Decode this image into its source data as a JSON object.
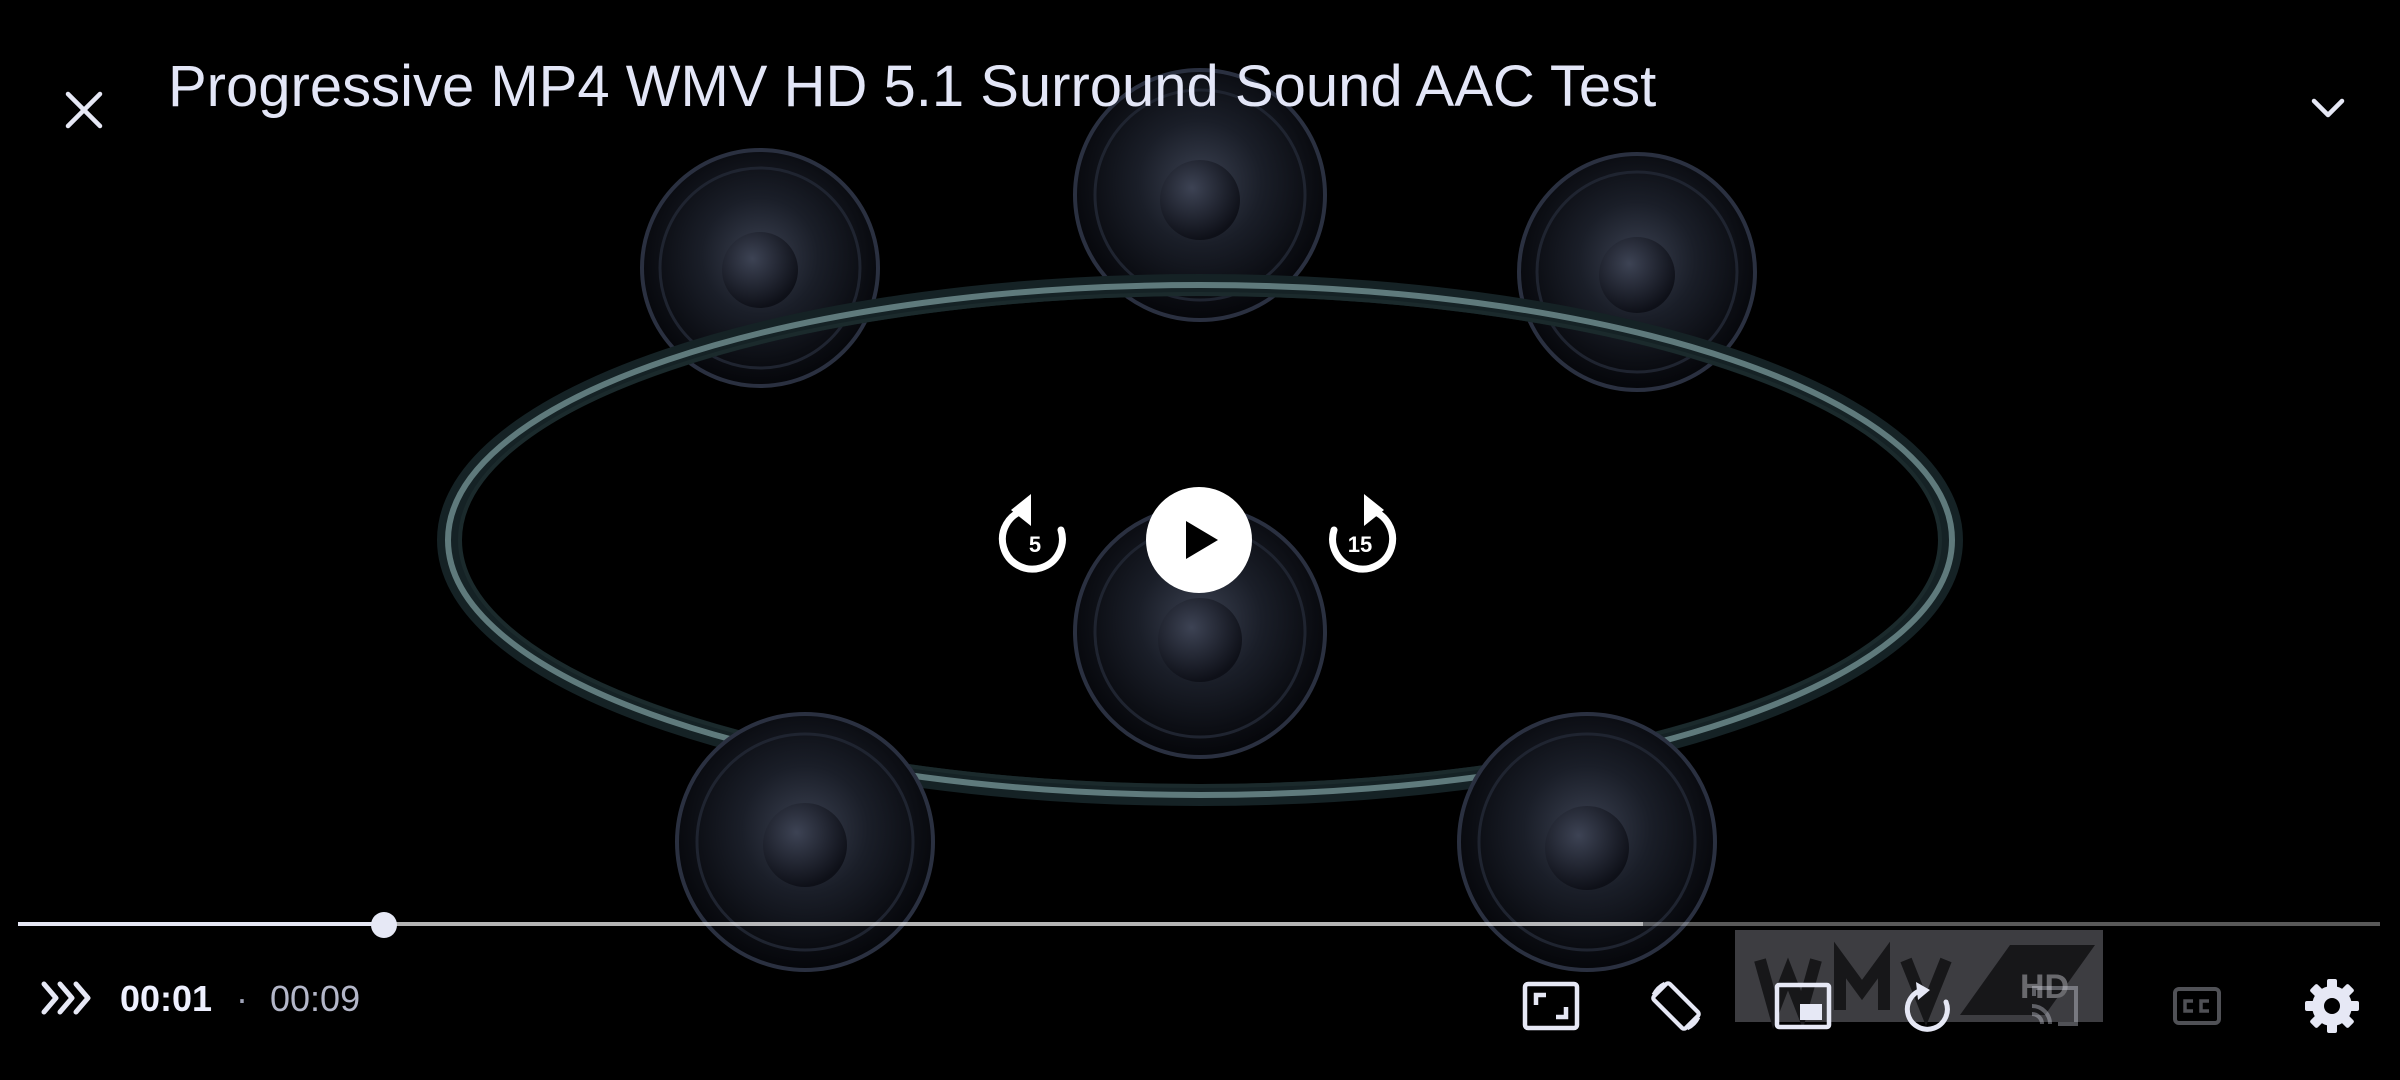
{
  "header": {
    "title": "Progressive MP4 WMV HD 5.1 Surround Sound AAC Test",
    "close_icon": "close-icon",
    "collapse_icon": "chevron-down-icon"
  },
  "controls": {
    "rewind_seconds": "5",
    "forward_seconds": "15",
    "play_icon": "play-icon"
  },
  "playback": {
    "current_time": "00:01",
    "separator": "·",
    "total_time": "00:09",
    "played_fraction": 0.155,
    "buffered_fraction": 0.688
  },
  "toolbar": {
    "icons": [
      "speed-icon",
      "fullscreen-icon",
      "rotate-screen-icon",
      "picture-in-picture-icon",
      "repeat-icon",
      "cast-icon",
      "closed-captions-icon",
      "settings-icon"
    ]
  },
  "watermark": {
    "text": "WMV HD"
  },
  "colors": {
    "foreground": "#e6e8f5",
    "background": "#000000"
  }
}
